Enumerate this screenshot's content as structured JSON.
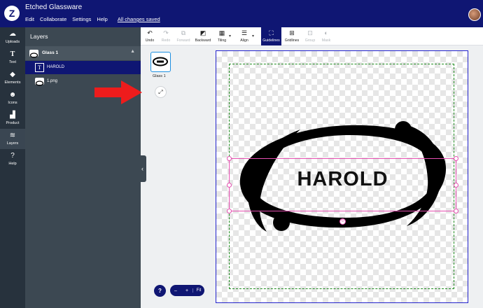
{
  "app": {
    "title": "Etched Glassware",
    "menu": [
      "Edit",
      "Collaborate",
      "Settings",
      "Help"
    ],
    "save_status": "All changes saved"
  },
  "rail": [
    {
      "label": "Uploads",
      "icon": "cloud-upload-icon"
    },
    {
      "label": "Text",
      "icon": "text-icon"
    },
    {
      "label": "Elements",
      "icon": "elements-icon"
    },
    {
      "label": "Icons",
      "icon": "smiley-icon"
    },
    {
      "label": "Product",
      "icon": "product-icon"
    },
    {
      "label": "Layers",
      "icon": "layers-icon"
    },
    {
      "label": "Help",
      "icon": "help-icon"
    }
  ],
  "layers": {
    "title": "Layers",
    "group": "Glass 1",
    "items": [
      {
        "label": "HAROLD",
        "type": "text"
      },
      {
        "label": "1.png",
        "type": "image"
      }
    ]
  },
  "toolbar": [
    {
      "label": "Undo",
      "icon": "undo-icon"
    },
    {
      "label": "Redo",
      "icon": "redo-icon"
    },
    {
      "label": "Forward",
      "icon": "forward-icon"
    },
    {
      "label": "Backward",
      "icon": "backward-icon"
    },
    {
      "label": "Tiling",
      "icon": "tiling-icon"
    },
    {
      "label": "Align",
      "icon": "align-icon"
    },
    {
      "label": "Guidelines",
      "icon": "guidelines-icon"
    },
    {
      "label": "Gridlines",
      "icon": "gridlines-icon"
    },
    {
      "label": "Group",
      "icon": "group-icon"
    },
    {
      "label": "Mask",
      "icon": "mask-icon"
    }
  ],
  "canvas": {
    "product_label": "Glass 1",
    "design_text": "HAROLD"
  },
  "zoom": {
    "minus": "–",
    "plus": "+",
    "fit": "Fit"
  },
  "colors": {
    "brand": "#0f1673",
    "selection": "#e64fb1",
    "guides": "#1e8a1e",
    "canvas_border": "#2222cc"
  }
}
